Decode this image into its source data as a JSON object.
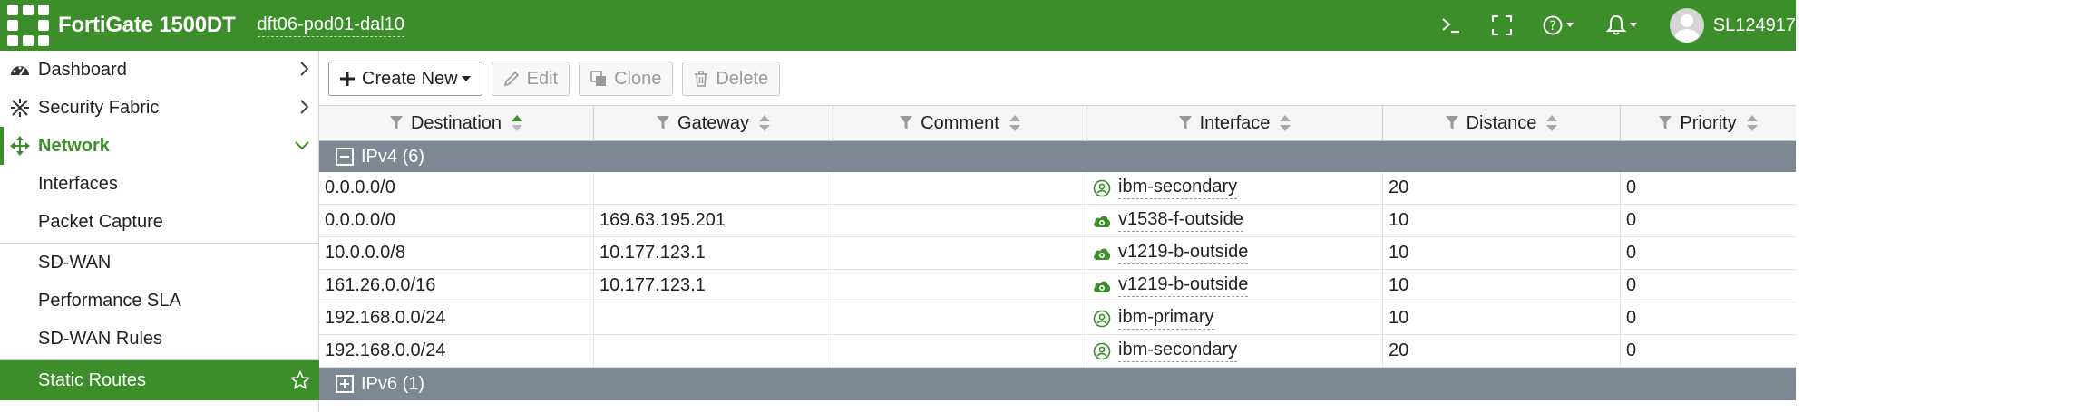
{
  "header": {
    "brand": "FortiGate 1500DT",
    "hostname": "dft06-pod01-dal10",
    "username": "SL124917",
    "icons": [
      "cli-console-icon",
      "fullscreen-icon",
      "help-icon",
      "notifications-bell-icon",
      "user-avatar"
    ],
    "color": "#3b8e2a"
  },
  "sidebar": {
    "items": [
      {
        "label": "Dashboard",
        "icon": "dashboard-icon",
        "chevron": "right"
      },
      {
        "label": "Security Fabric",
        "icon": "security-fabric-icon",
        "chevron": "right"
      },
      {
        "label": "Network",
        "icon": "network-icon",
        "chevron": "down",
        "active": true
      },
      {
        "label": "Interfaces"
      },
      {
        "label": "Packet Capture"
      },
      {
        "label": "SD-WAN"
      },
      {
        "label": "Performance SLA"
      },
      {
        "label": "SD-WAN Rules"
      },
      {
        "label": "Static Routes",
        "selected": true,
        "icon": "favorite-star-icon"
      }
    ]
  },
  "toolbar": {
    "create_new": "Create New",
    "edit": "Edit",
    "clone": "Clone",
    "delete": "Delete"
  },
  "table": {
    "columns": [
      "Destination",
      "Gateway",
      "Comment",
      "Interface",
      "Distance",
      "Priority"
    ],
    "sorted_column": "Destination",
    "groups": [
      {
        "label": "IPv4 (6)",
        "expanded": true,
        "rows": [
          {
            "destination": "0.0.0.0/0",
            "gateway": "",
            "comment": "",
            "interface": "ibm-secondary",
            "iface_type": "tunnel",
            "distance": "20",
            "priority": "0"
          },
          {
            "destination": "0.0.0.0/0",
            "gateway": "169.63.195.201",
            "comment": "",
            "interface": "v1538-f-outside",
            "iface_type": "wan",
            "distance": "10",
            "priority": "0"
          },
          {
            "destination": "10.0.0.0/8",
            "gateway": "10.177.123.1",
            "comment": "",
            "interface": "v1219-b-outside",
            "iface_type": "wan",
            "distance": "10",
            "priority": "0"
          },
          {
            "destination": "161.26.0.0/16",
            "gateway": "10.177.123.1",
            "comment": "",
            "interface": "v1219-b-outside",
            "iface_type": "wan",
            "distance": "10",
            "priority": "0"
          },
          {
            "destination": "192.168.0.0/24",
            "gateway": "",
            "comment": "",
            "interface": "ibm-primary",
            "iface_type": "tunnel",
            "distance": "10",
            "priority": "0"
          },
          {
            "destination": "192.168.0.0/24",
            "gateway": "",
            "comment": "",
            "interface": "ibm-secondary",
            "iface_type": "tunnel",
            "distance": "20",
            "priority": "0"
          }
        ]
      },
      {
        "label": "IPv6 (1)",
        "expanded": false,
        "rows": []
      }
    ]
  }
}
